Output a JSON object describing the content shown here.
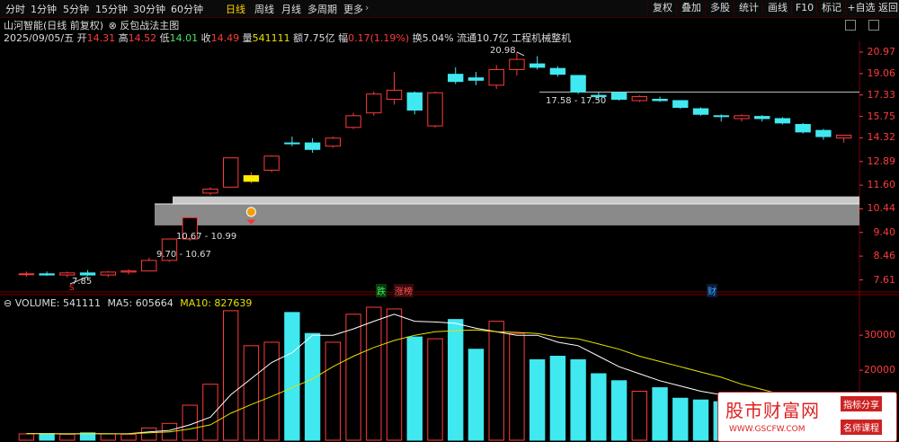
{
  "toolbar": {
    "timeframes": [
      "分时",
      "1分钟",
      "5分钟",
      "15分钟",
      "30分钟",
      "60分钟",
      "日线",
      "周线",
      "月线",
      "多周期",
      "更多"
    ],
    "active_timeframe": "日线",
    "right_buttons": [
      "复权",
      "叠加",
      "多股",
      "统计",
      "画线",
      "F10",
      "标记",
      "+自选",
      "返回"
    ]
  },
  "header": {
    "stock_name": "山河智能",
    "chart_mode": "(日线 前复权)",
    "indicator": "反包战法主图",
    "date": "2025/09/05/五",
    "open_label": "开",
    "open": "14.31",
    "high_label": "高",
    "high": "14.52",
    "low_label": "低",
    "low": "14.01",
    "close_label": "收",
    "close": "14.49",
    "volume_label": "量",
    "volume": "541111",
    "amount_label": "额",
    "amount": "7.75亿",
    "change_label": "幅",
    "change": "0.17(1.19%)",
    "turnover_label": "换",
    "turnover": "5.04%",
    "float_label": "流通",
    "float_value": "10.7亿",
    "sector": "工程机械整机"
  },
  "volume_header": {
    "name": "VOLUME: 541111",
    "ma5": "MA5: 605664",
    "ma10": "MA10: 827639"
  },
  "colors": {
    "up": "#ff3b3b",
    "down": "#40e8f0",
    "ma5": "#ffffff",
    "ma10": "#e8e000",
    "grid": "#7a0000",
    "bg": "#000000"
  },
  "chart_data": {
    "type": "candlestick",
    "price_axis_ticks": [
      7.61,
      8.46,
      9.4,
      10.44,
      11.6,
      12.89,
      14.32,
      15.75,
      17.33,
      19.06,
      20.97
    ],
    "price_range": [
      7.3,
      22.0
    ],
    "volume_axis_ticks": [
      20000,
      30000
    ],
    "volume_range": [
      0,
      38000
    ],
    "candles": [
      {
        "o": 7.8,
        "h": 7.9,
        "l": 7.72,
        "c": 7.82,
        "v": 1800
      },
      {
        "o": 7.82,
        "h": 7.9,
        "l": 7.75,
        "c": 7.78,
        "v": 1900
      },
      {
        "o": 7.78,
        "h": 7.9,
        "l": 7.7,
        "c": 7.85,
        "v": 1700
      },
      {
        "o": 7.85,
        "h": 7.95,
        "l": 7.75,
        "c": 7.78,
        "v": 2100
      },
      {
        "o": 7.78,
        "h": 7.92,
        "l": 7.7,
        "c": 7.88,
        "v": 1800
      },
      {
        "o": 7.88,
        "h": 7.98,
        "l": 7.8,
        "c": 7.92,
        "v": 1700
      },
      {
        "o": 7.92,
        "h": 8.4,
        "l": 7.9,
        "c": 8.3,
        "v": 3500
      },
      {
        "o": 8.3,
        "h": 9.13,
        "l": 8.25,
        "c": 9.13,
        "v": 4800
      },
      {
        "o": 9.13,
        "h": 10.04,
        "l": 9.05,
        "c": 10.04,
        "v": 10000
      },
      {
        "o": 11.2,
        "h": 11.5,
        "l": 11.1,
        "c": 11.4,
        "v": 16000
      },
      {
        "o": 11.5,
        "h": 13.1,
        "l": 11.5,
        "c": 13.1,
        "v": 37000
      },
      {
        "o": 11.8,
        "h": 12.3,
        "l": 11.7,
        "c": 12.1,
        "v": 27000
      },
      {
        "o": 12.4,
        "h": 13.25,
        "l": 12.3,
        "c": 13.2,
        "v": 28000
      },
      {
        "o": 14.0,
        "h": 14.4,
        "l": 13.8,
        "c": 13.95,
        "v": 36500
      },
      {
        "o": 14.0,
        "h": 14.3,
        "l": 13.4,
        "c": 13.6,
        "v": 30500
      },
      {
        "o": 13.8,
        "h": 14.4,
        "l": 13.7,
        "c": 14.3,
        "v": 28000
      },
      {
        "o": 15.0,
        "h": 16.0,
        "l": 14.9,
        "c": 15.8,
        "v": 36000
      },
      {
        "o": 16.0,
        "h": 17.6,
        "l": 15.8,
        "c": 17.4,
        "v": 38000
      },
      {
        "o": 17.0,
        "h": 19.2,
        "l": 16.6,
        "c": 17.7,
        "v": 37500
      },
      {
        "o": 17.5,
        "h": 17.6,
        "l": 15.9,
        "c": 16.2,
        "v": 29500
      },
      {
        "o": 15.1,
        "h": 17.6,
        "l": 15.0,
        "c": 17.5,
        "v": 29000
      },
      {
        "o": 19.0,
        "h": 19.6,
        "l": 18.2,
        "c": 18.4,
        "v": 34500
      },
      {
        "o": 18.7,
        "h": 19.2,
        "l": 18.1,
        "c": 18.5,
        "v": 26000
      },
      {
        "o": 18.1,
        "h": 19.8,
        "l": 17.8,
        "c": 19.4,
        "v": 34000
      },
      {
        "o": 19.4,
        "h": 20.98,
        "l": 18.9,
        "c": 20.3,
        "v": 30500
      },
      {
        "o": 19.9,
        "h": 20.6,
        "l": 19.4,
        "c": 19.6,
        "v": 23000
      },
      {
        "o": 19.5,
        "h": 19.7,
        "l": 18.8,
        "c": 19.0,
        "v": 24000
      },
      {
        "o": 18.9,
        "h": 18.9,
        "l": 17.4,
        "c": 17.55,
        "v": 23000
      },
      {
        "o": 17.3,
        "h": 17.55,
        "l": 16.9,
        "c": 17.2,
        "v": 19000
      },
      {
        "o": 17.5,
        "h": 17.6,
        "l": 16.9,
        "c": 17.0,
        "v": 17000
      },
      {
        "o": 16.9,
        "h": 17.3,
        "l": 16.8,
        "c": 17.2,
        "v": 14000
      },
      {
        "o": 17.0,
        "h": 17.2,
        "l": 16.8,
        "c": 16.9,
        "v": 15000
      },
      {
        "o": 16.9,
        "h": 16.9,
        "l": 16.3,
        "c": 16.4,
        "v": 12000
      },
      {
        "o": 16.3,
        "h": 16.4,
        "l": 15.8,
        "c": 15.9,
        "v": 11500
      },
      {
        "o": 15.8,
        "h": 15.9,
        "l": 15.4,
        "c": 15.75,
        "v": 11000
      },
      {
        "o": 15.6,
        "h": 15.9,
        "l": 15.4,
        "c": 15.8,
        "v": 9000
      },
      {
        "o": 15.75,
        "h": 15.85,
        "l": 15.4,
        "c": 15.6,
        "v": 7000
      },
      {
        "o": 15.6,
        "h": 15.7,
        "l": 15.2,
        "c": 15.3,
        "v": 8500
      },
      {
        "o": 15.2,
        "h": 15.3,
        "l": 14.6,
        "c": 14.7,
        "v": 6000
      },
      {
        "o": 14.8,
        "h": 14.9,
        "l": 14.2,
        "c": 14.4,
        "v": 5500
      },
      {
        "o": 14.31,
        "h": 14.52,
        "l": 14.01,
        "c": 14.49,
        "v": 5400
      }
    ],
    "ma5": [
      1900,
      1850,
      1800,
      1850,
      1820,
      1840,
      2400,
      2800,
      4400,
      6600,
      13000,
      17600,
      22200,
      25000,
      30000,
      30000,
      31800,
      34000,
      36000,
      34000,
      33800,
      33400,
      32000,
      31000,
      30000,
      30000,
      28000,
      27000,
      24000,
      21000,
      19000,
      17000,
      15500,
      14000,
      13000,
      11700,
      10500,
      9400,
      8400,
      7200,
      6480
    ],
    "ma10": [
      1900,
      1870,
      1850,
      1850,
      1840,
      1820,
      2100,
      2400,
      3200,
      4400,
      7700,
      10200,
      12500,
      15000,
      17500,
      21000,
      24000,
      26500,
      28500,
      30000,
      31000,
      31300,
      31500,
      31000,
      30800,
      30500,
      29500,
      29000,
      27500,
      26000,
      24000,
      22500,
      21000,
      19500,
      18000,
      16000,
      14500,
      13000,
      11500,
      10000,
      8800
    ],
    "zones": [
      {
        "label": "10.67 - 10.99",
        "low": 10.67,
        "high": 10.99
      },
      {
        "label": "9.70 - 10.67",
        "low": 9.7,
        "high": 10.67
      }
    ],
    "resistance": {
      "label": "17.58 - 17.50",
      "value": 17.55
    },
    "peak_label": "20.98",
    "low_label": "7.85",
    "event_marks": [
      "跌",
      "涨榜",
      "财"
    ]
  },
  "watermark": {
    "title": "股市财富网",
    "sub1": "指标分享",
    "url": "WWW.GSCFW.COM",
    "sub2": "名师课程"
  }
}
